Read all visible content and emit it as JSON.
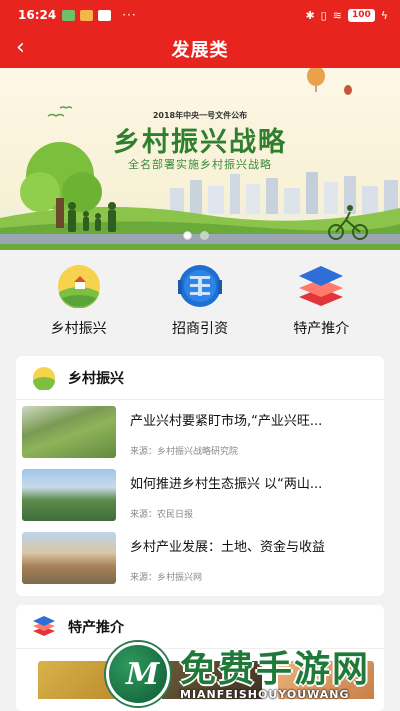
{
  "status_bar": {
    "time": "16:24",
    "battery": "100",
    "more": "···"
  },
  "header": {
    "back_icon": "‹",
    "title": "发展类"
  },
  "banner": {
    "supertitle": "2018年中央一号文件公布",
    "headline": "乡村振兴战略",
    "subtitle": "全名部署实施乡村振兴战略",
    "slide_count": 2,
    "active_slide": 1
  },
  "categories": [
    {
      "label": "乡村振兴",
      "icon": "village-landscape-icon"
    },
    {
      "label": "招商引资",
      "icon": "investment-coin-icon"
    },
    {
      "label": "特产推介",
      "icon": "layers-stack-icon"
    }
  ],
  "section_village": {
    "title": "乡村振兴",
    "items": [
      {
        "title": "产业兴村要紧盯市场,“产业兴旺...",
        "source": "来源：乡村振兴战略研究院"
      },
      {
        "title": "如何推进乡村生态振兴 以“两山...",
        "source": "来源：农民日报"
      },
      {
        "title": "乡村产业发展：土地、资金与收益",
        "source": "来源：乡村振兴网"
      }
    ]
  },
  "section_products": {
    "title": "特产推介"
  },
  "watermark": {
    "logo_letter": "M",
    "text": "免费手游网",
    "pinyin": "MIANFEISHOUYOUWANG"
  },
  "colors": {
    "brand_red": "#e8241f",
    "headline_green": "#2f7f2f"
  }
}
